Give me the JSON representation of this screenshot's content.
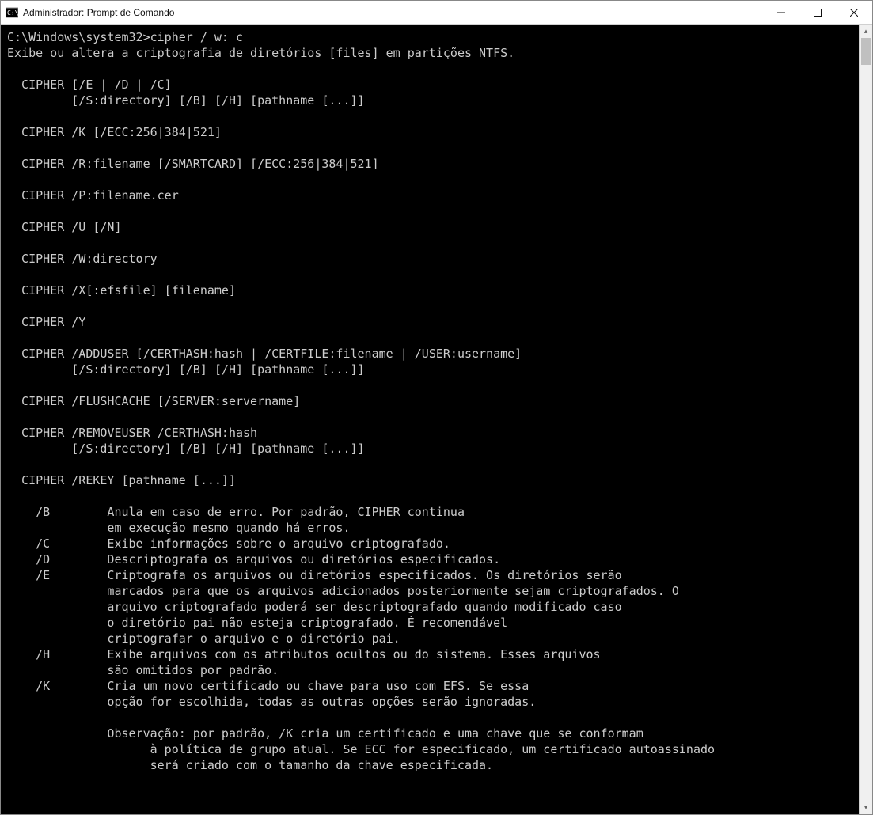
{
  "window": {
    "title": "Administrador: Prompt de Comando"
  },
  "console": {
    "prompt": "C:\\Windows\\system32>",
    "command": "cipher / w: c",
    "output_lines": [
      "Exibe ou altera a criptografia de diretórios [files] em partições NTFS.",
      "",
      "  CIPHER [/E | /D | /C]",
      "         [/S:directory] [/B] [/H] [pathname [...]]",
      "",
      "  CIPHER /K [/ECC:256|384|521]",
      "",
      "  CIPHER /R:filename [/SMARTCARD] [/ECC:256|384|521]",
      "",
      "  CIPHER /P:filename.cer",
      "",
      "  CIPHER /U [/N]",
      "",
      "  CIPHER /W:directory",
      "",
      "  CIPHER /X[:efsfile] [filename]",
      "",
      "  CIPHER /Y",
      "",
      "  CIPHER /ADDUSER [/CERTHASH:hash | /CERTFILE:filename | /USER:username]",
      "         [/S:directory] [/B] [/H] [pathname [...]]",
      "",
      "  CIPHER /FLUSHCACHE [/SERVER:servername]",
      "",
      "  CIPHER /REMOVEUSER /CERTHASH:hash",
      "         [/S:directory] [/B] [/H] [pathname [...]]",
      "",
      "  CIPHER /REKEY [pathname [...]]",
      "",
      "    /B        Anula em caso de erro. Por padrão, CIPHER continua",
      "              em execução mesmo quando há erros.",
      "    /C        Exibe informações sobre o arquivo criptografado.",
      "    /D        Descriptografa os arquivos ou diretórios especificados.",
      "    /E        Criptografa os arquivos ou diretórios especificados. Os diretórios serão",
      "              marcados para que os arquivos adicionados posteriormente sejam criptografados. O",
      "              arquivo criptografado poderá ser descriptografado quando modificado caso",
      "              o diretório pai não esteja criptografado. É recomendável",
      "              criptografar o arquivo e o diretório pai.",
      "    /H        Exibe arquivos com os atributos ocultos ou do sistema. Esses arquivos",
      "              são omitidos por padrão.",
      "    /K        Cria um novo certificado ou chave para uso com EFS. Se essa",
      "              opção for escolhida, todas as outras opções serão ignoradas.",
      "",
      "              Observação: por padrão, /K cria um certificado e uma chave que se conformam",
      "                    à política de grupo atual. Se ECC for especificado, um certificado autoassinado",
      "                    será criado com o tamanho da chave especificada."
    ]
  }
}
